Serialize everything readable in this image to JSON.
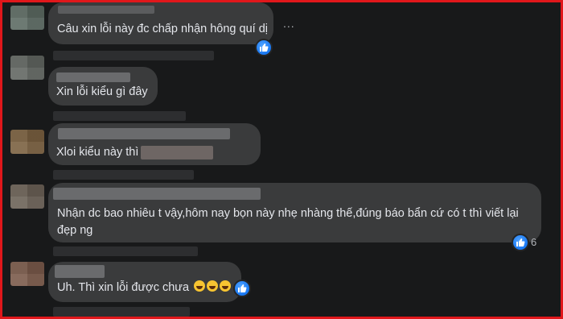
{
  "comments": [
    {
      "text": "Câu xin lỗi này đc chấp nhận hông quí dị"
    },
    {
      "text": "Xin lỗi kiểu gì đây"
    },
    {
      "text": "Xloi kiểu này thì"
    },
    {
      "text": "Nhận dc bao nhiêu t vậy,hôm nay bọn này nhẹ nhàng thế,đúng báo bẩn cứ có t thì viết lại",
      "text2": "đẹp ng",
      "reaction_count": "6"
    },
    {
      "text": "Uh. Thì xin lỗi được chưa"
    }
  ],
  "more_options": "...",
  "accent_color": "#1877f2",
  "frame_color": "#e0171b"
}
